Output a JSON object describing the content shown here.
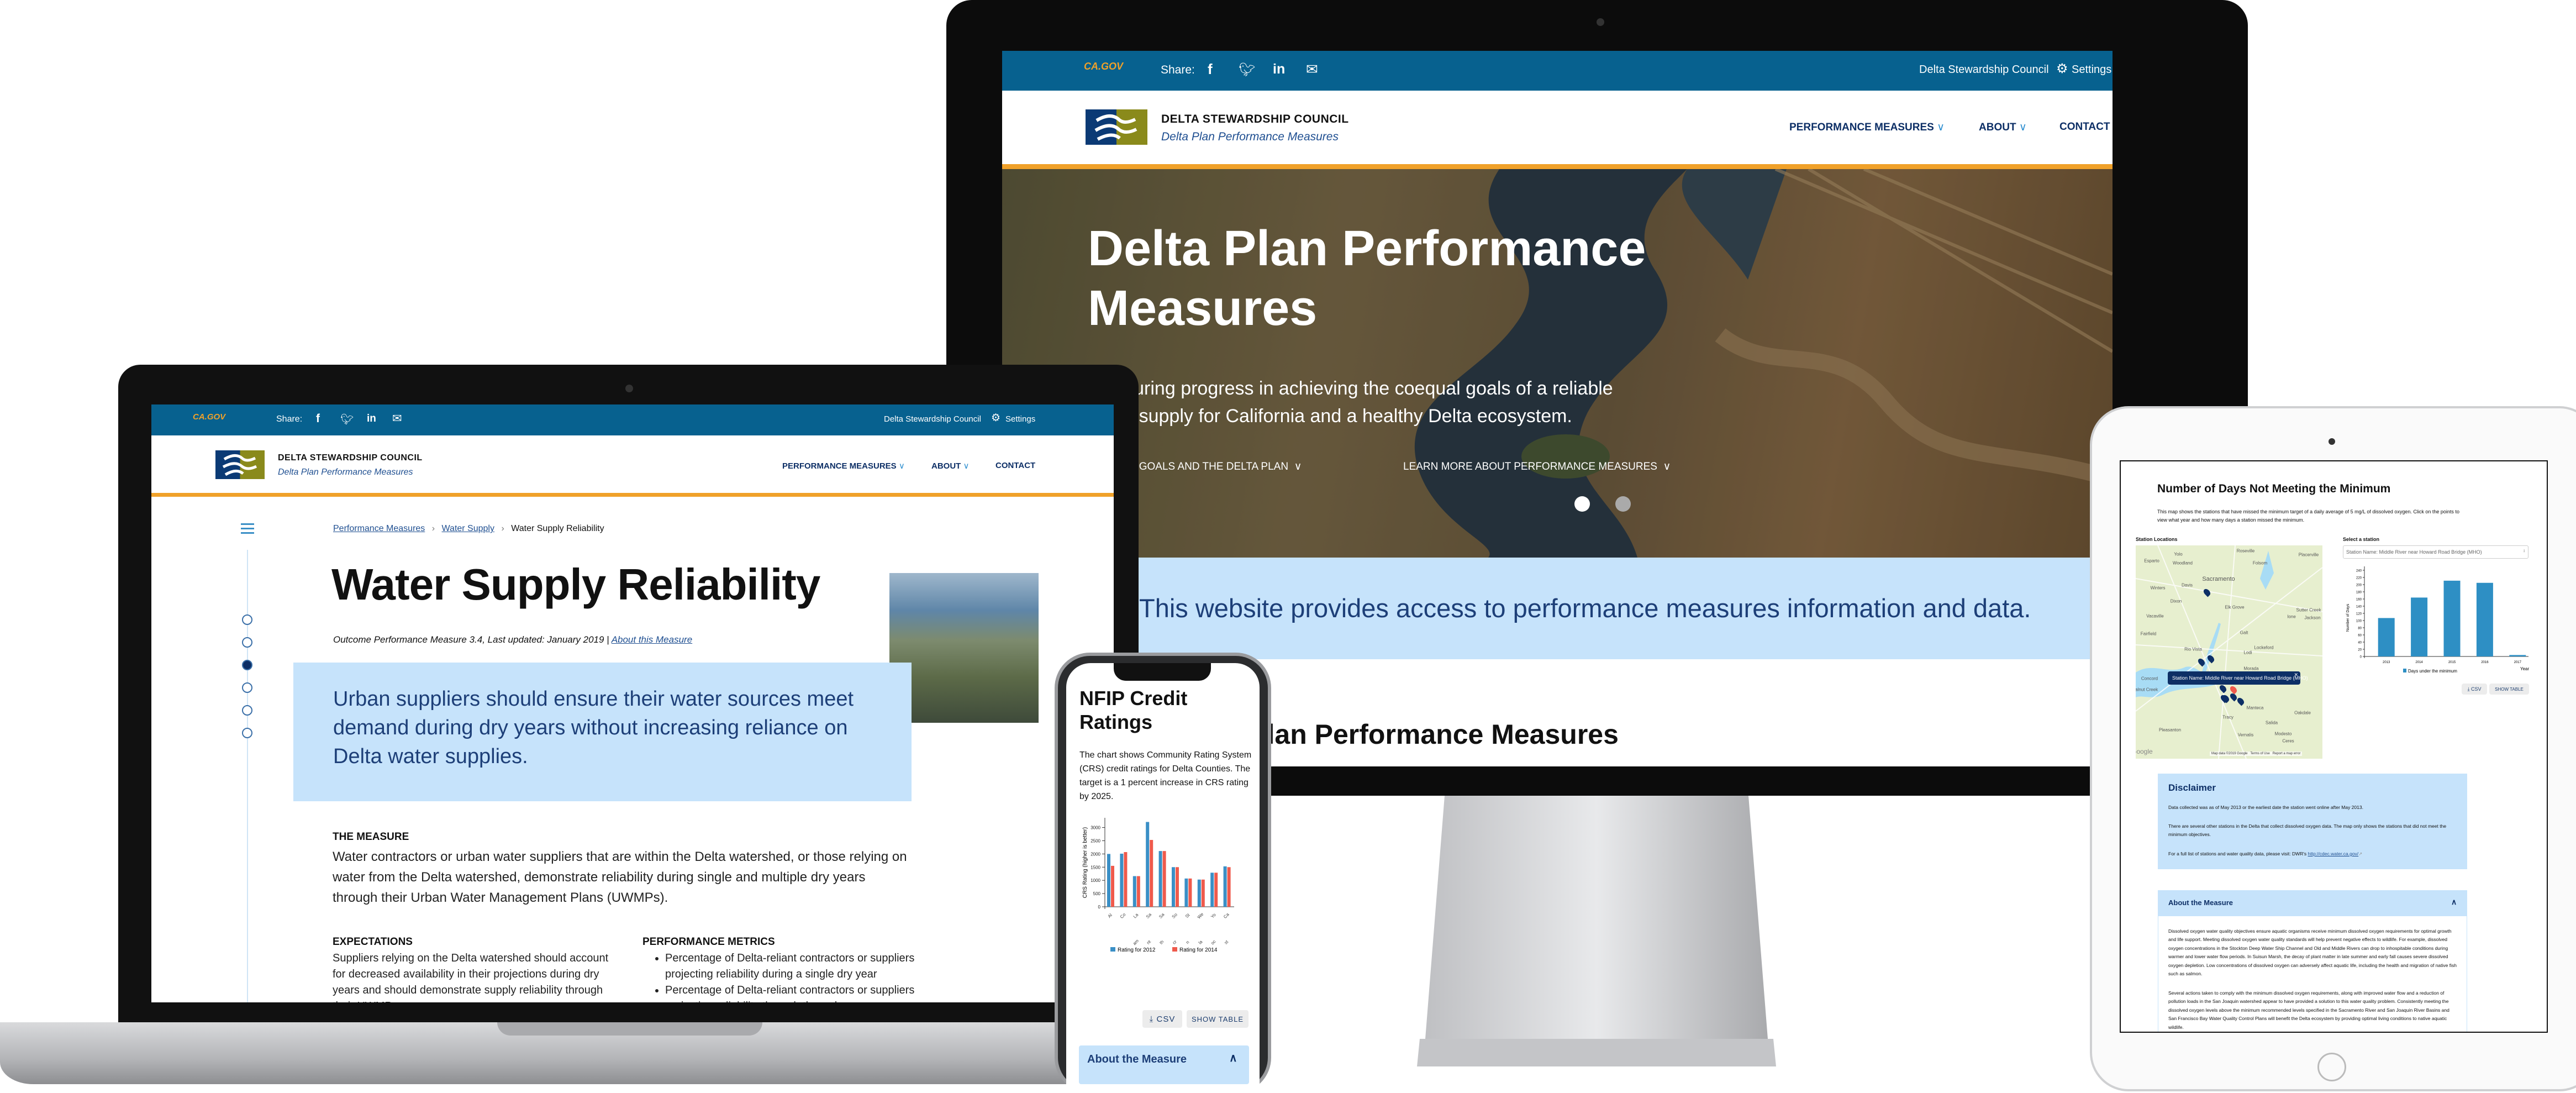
{
  "colors": {
    "topbar": "#07618f",
    "navy": "#0d2f66",
    "orange": "#f0a129",
    "light_blue": "#c6e3fb",
    "series_2012": "#3a8fc6",
    "series_2014": "#ef5a4c",
    "tablet_bar": "#2e8fc4"
  },
  "site": {
    "gov_logo": "CA.GOV",
    "share_label": "Share:",
    "share_icons": [
      "facebook-icon",
      "twitter-icon",
      "linkedin-icon",
      "email-icon"
    ],
    "org_link": "Delta Stewardship Council",
    "settings": "Settings",
    "org_name": "DELTA STEWARDSHIP COUNCIL",
    "site_name": "Delta Plan Performance Measures",
    "nav": [
      {
        "label": "PERFORMANCE MEASURES",
        "dropdown": true
      },
      {
        "label": "ABOUT",
        "dropdown": true
      },
      {
        "label": "CONTACT",
        "dropdown": false
      }
    ]
  },
  "desktop": {
    "hero_title": "Delta Plan Performance Measures",
    "hero_subtitle": "Measuring progress in achieving the coequal goals of a reliable water supply for California and a healthy Delta ecosystem.",
    "hero_links": [
      "LEARN MORE ABOUT COEQUAL GOALS AND THE DELTA PLAN",
      "LEARN MORE ABOUT PERFORMANCE MEASURES"
    ],
    "carousel": {
      "slides": 2,
      "active": 1
    },
    "band_text": "This website provides access to performance measures information and data.",
    "section_heading": "Delta Plan Performance Measures"
  },
  "laptop": {
    "breadcrumb": [
      "Performance Measures",
      "Water Supply",
      "Water Supply Reliability"
    ],
    "title": "Water Supply Reliability",
    "meta": "Outcome Performance Measure 3.4, Last updated: January 2019 |",
    "meta_link": "About this Measure",
    "side_nav": {
      "count": 6,
      "active": 3
    },
    "quote": "Urban suppliers should ensure their water sources meet demand during dry years without increasing reliance on Delta water supplies.",
    "measure_heading": "THE MEASURE",
    "measure_text": "Water contractors or urban water suppliers that are within the Delta watershed, or those relying on water from the Delta watershed, demonstrate reliability during single and multiple dry years through their Urban Water Management Plans (UWMPs).",
    "expectations_heading": "EXPECTATIONS",
    "expectations_text": "Suppliers relying on the Delta watershed should account for decreased availability in their projections during dry years and should demonstrate supply reliability through their UWMPs.",
    "metrics_heading": "PERFORMANCE METRICS",
    "metrics": [
      "Percentage of Delta-reliant contractors or suppliers projecting reliability during a single dry year",
      "Percentage of Delta-reliant contractors or suppliers projecting reliability through three dry years"
    ]
  },
  "phone": {
    "title": "NFIP Credit Ratings",
    "description": "The chart shows Community Rating System (CRS) credit ratings for Delta Counties.  The target is a 1 percent increase in CRS rating by 2025.",
    "csv_button": "CSV",
    "show_table_button": "SHOW TABLE",
    "accordion": "About the Measure"
  },
  "tablet": {
    "title": "Number of Days Not Meeting the Minimum",
    "description": "This map shows the stations that have missed the minimum target of a daily average of 5 mg/L of dissolved oxygen. Click on the points to view what year and how many days a station missed the minimum.",
    "map_label": "Station Locations",
    "select_label": "Select a station",
    "select_value": "Station Name: Middle River near Howard Road Bridge (MHO)",
    "map_popup": "Station Name: Middle River near Howard Road Bridge (MHO)",
    "map_places": [
      "Roseville",
      "Yolo",
      "Placerville",
      "Esparto",
      "Woodland",
      "Folsom",
      "Sacramento",
      "Davis",
      "Winters",
      "Dixon",
      "Elk Grove",
      "Sutter Creek",
      "Vacaville",
      "Ione",
      "Jackson",
      "Fairfield",
      "Galt",
      "Rio Vista",
      "Lockeford",
      "Lodi",
      "Morada",
      "Concord",
      "Walnut Creek",
      "Manteca",
      "Oakdale",
      "Tracy",
      "Salida",
      "Pleasanton",
      "Vernalis",
      "Modesto",
      "Ceres"
    ],
    "map_attribution": [
      "Google",
      "Map data ©2019 Google",
      "Terms of Use",
      "Report a map error"
    ],
    "csv_button": "CSV",
    "show_table_button": "SHOW TABLE",
    "disclaimer_title": "Disclaimer",
    "disclaimer": [
      "Data collected was as of May 2013 or the earliest date the station went online after May 2013.",
      "There are several other stations in the Delta that collect dissolved oxygen data. The map only shows the stations that did not meet the minimum objectives.",
      "For a full list of stations and water quality data, please visit: DWR's"
    ],
    "disclaimer_link": "http://cdec.water.ca.gov/",
    "about_title": "About the Measure",
    "about": [
      "Dissolved oxygen water quality objectives ensure aquatic organisms receive minimum dissolved oxygen requirements for optimal growth and life support. Meeting dissolved oxygen water quality standards will help prevent negative effects to wildlife. For example, dissolved oxygen concentrations in the Stockton Deep Water Ship Channel and Old and Middle Rivers can drop to inhospitable conditions during warmer and lower water flow periods. In Suisun Marsh, the decay of plant matter in late summer and early fall causes severe dissolved oxygen depletion. Low concentrations of dissolved oxygen can adversely affect aquatic life, including the health and migration of native fish such as salmon.",
      "Several actions taken to comply with the minimum dissolved oxygen requirements, along with improved water flow and a reduction of pollution loads in the San Joaquin watershed appear to have provided a solution to this water quality problem. Consistently meeting the dissolved oxygen levels above the minimum recommended levels specified in the Sacramento River and San Joaquin River Basins and San Francisco Bay Water Quality Control Plans will benefit the Delta ecosystem by providing optimal living conditions to native aquatic wildlife."
    ]
  },
  "chart_data": [
    {
      "type": "bar",
      "title": "",
      "ylabel": "CRS Rating (higher is better)",
      "xlabel": "",
      "categories": [
        [
          "Al"
        ],
        [
          "Co"
        ],
        [
          "La",
          "am"
        ],
        [
          "Sa",
          "nt"
        ],
        [
          "Sa",
          "th"
        ],
        [
          "So",
          "cr"
        ],
        [
          "St",
          "n"
        ],
        [
          "We",
          "la"
        ],
        [
          "Yo",
          "oc"
        ],
        [
          "Ca",
          "st"
        ]
      ],
      "series": [
        {
          "name": "Rating for 2012",
          "values": [
            2000,
            2010,
            1160,
            3210,
            2110,
            1500,
            1070,
            1030,
            1290,
            1530
          ]
        },
        {
          "name": "Rating for 2014",
          "values": [
            1550,
            2070,
            1160,
            2530,
            2110,
            1500,
            1070,
            1030,
            1290,
            1500
          ]
        }
      ],
      "yticks": [
        0,
        500,
        1000,
        1500,
        2000,
        2500,
        3000
      ],
      "ylim": [
        0,
        3200
      ],
      "legend": "bottom",
      "grid": false
    },
    {
      "type": "bar",
      "title": "",
      "ylabel": "Number of Days",
      "xlabel": "Year",
      "categories": [
        "2013",
        "2014",
        "2015",
        "2016",
        "2017"
      ],
      "series": [
        {
          "name": "Days under the minimum",
          "values": [
            107,
            164,
            211,
            205,
            4
          ]
        }
      ],
      "yticks": [
        0,
        20,
        40,
        60,
        80,
        100,
        120,
        140,
        160,
        180,
        200,
        220,
        240
      ],
      "ylim": [
        0,
        245
      ],
      "legend": "bottom",
      "grid": false
    }
  ]
}
